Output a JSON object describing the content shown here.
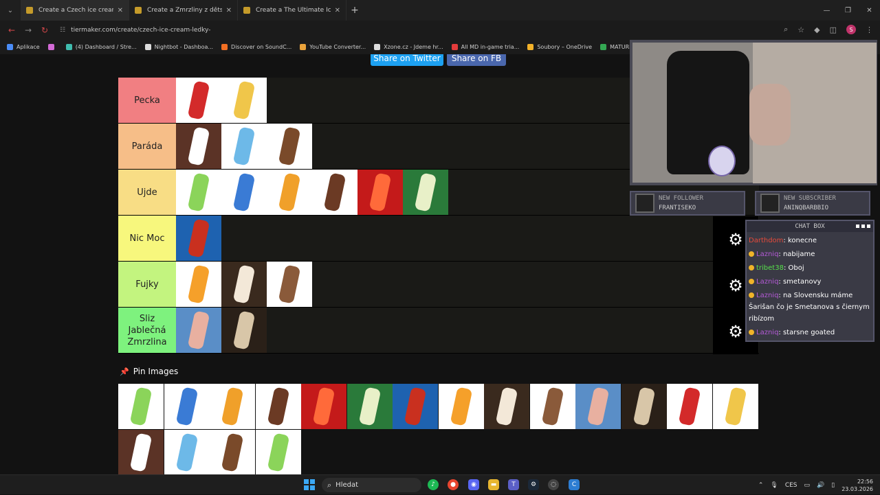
{
  "browser": {
    "tabs": [
      {
        "title": "Create a Czech ice cream (ledňá",
        "active": true
      },
      {
        "title": "Create a Zmrzliny z dětství Tier",
        "active": false
      },
      {
        "title": "Create a The Ultimate Ice Cream",
        "active": false
      }
    ],
    "new_tab": "+",
    "url": "tiermaker.com/create/czech-ice-cream-ledky-",
    "bookmarks": [
      {
        "label": "Aplikace",
        "color": "#4a8cf7"
      },
      {
        "label": "",
        "color": "#d36ad6"
      },
      {
        "label": "(4) Dashboard / Stre...",
        "color": "#3fbcae"
      },
      {
        "label": "Nightbot - Dashboa...",
        "color": "#dddddd"
      },
      {
        "label": "Discover on SoundC...",
        "color": "#f26f23"
      },
      {
        "label": "YouTube Converter...",
        "color": "#e9a23b"
      },
      {
        "label": "Xzone.cz - Jdeme hr...",
        "color": "#dddddd"
      },
      {
        "label": "All MD in-game tria...",
        "color": "#e33b3b"
      },
      {
        "label": "Soubory – OneDrive",
        "color": "#f3b229"
      },
      {
        "label": "MATURITA_OKRUH...",
        "color": "#34a853"
      }
    ]
  },
  "share": {
    "twitter": "Share on Twitter",
    "facebook": "Share on FB"
  },
  "tiers": [
    {
      "label": "Pecka",
      "color": "#f17f82",
      "items": 2
    },
    {
      "label": "Paráda",
      "color": "#f6be88",
      "items": 3
    },
    {
      "label": "Ujde",
      "color": "#f8dd85",
      "items": 6
    },
    {
      "label": "Nic Moc",
      "color": "#f7f77d",
      "items": 1
    },
    {
      "label": "Fujky",
      "color": "#c3f47f",
      "items": 3
    },
    {
      "label": "Sliz Jablečná Zmrzlina",
      "color": "#7ef27e",
      "items": 2
    }
  ],
  "pin_images": "Pin Images",
  "overlay": {
    "new_follower_title": "NEW FOLLOWER",
    "new_follower_name": "FRANTISEKO",
    "new_subscriber_title": "NEW SUBSCRIBER",
    "new_subscriber_name": "ANINQBARBBIO",
    "chat_title": "CHAT BOX",
    "messages": [
      {
        "user": "Darthdom",
        "color": "#e84a3a",
        "text": ": konecne"
      },
      {
        "user": "Lazniq",
        "color": "#b45ad6",
        "text": ": nabijame"
      },
      {
        "user": "tribet38",
        "color": "#56e04a",
        "text": ": Oboj"
      },
      {
        "user": "Lazniq",
        "color": "#b45ad6",
        "text": ": smetanovy"
      },
      {
        "user": "Lazniq",
        "color": "#b45ad6",
        "text": ": na Slovensku máme Šarišan čo je Smetanova s čiernym ribízom"
      },
      {
        "user": "Lazniq",
        "color": "#b45ad6",
        "text": ": starsne goated"
      }
    ]
  },
  "taskbar": {
    "search": "Hledat",
    "lang": "CES",
    "time": "22:56",
    "date": "23.03.2026"
  }
}
